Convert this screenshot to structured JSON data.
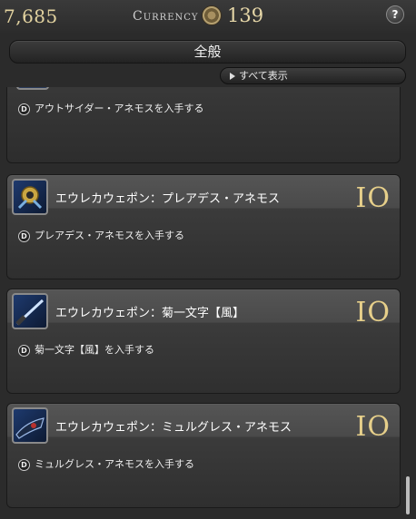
{
  "header": {
    "gil": "7,685",
    "currency_label": "Currency",
    "currency_value": "139",
    "help_label": "?"
  },
  "category": {
    "label": "全般"
  },
  "show_all": {
    "label": "すべて表示"
  },
  "items": [
    {
      "condition": "アウトサイダー・アネモスを入手する"
    },
    {
      "title": "エウレカウェポン：プレアデス・アネモス",
      "value": "IO",
      "condition": "プレアデス・アネモスを入手する",
      "icon": "pleiades-weapon-icon"
    },
    {
      "title": "エウレカウェポン：菊一文字【風】",
      "value": "IO",
      "condition": "菊一文字【風】を入手する",
      "icon": "kikuichimonji-weapon-icon"
    },
    {
      "title": "エウレカウェポン：ミュルグレス・アネモス",
      "value": "IO",
      "condition": "ミュルグレス・アネモスを入手する",
      "icon": "murgleis-weapon-icon"
    }
  ],
  "colors": {
    "accent_gold": "#e6cf8a",
    "background": "#2b2b2b"
  }
}
